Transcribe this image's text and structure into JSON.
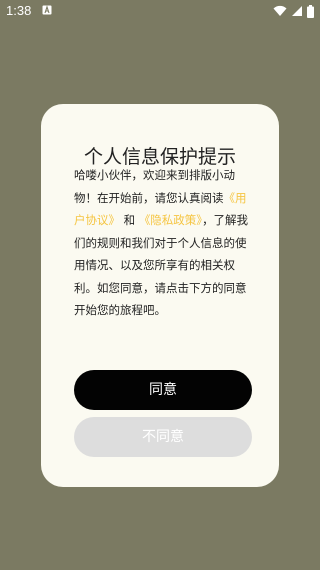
{
  "status_bar": {
    "time": "1:38",
    "notification_icon": "a-box-icon",
    "right_icons": [
      "wifi-icon",
      "cellular-signal-icon",
      "battery-icon"
    ]
  },
  "dialog": {
    "title": "个人信息保护提示",
    "body": {
      "intro": "哈喽小伙伴，欢迎来到排版小动物！在开始前，请您认真阅读",
      "user_agreement_link": "《用户协议》",
      "and": "和",
      "privacy_policy_link": "《隐私政策》",
      "outro": "，了解我们的规则和我们对于个人信息的使用情况、以及您所享有的相关权利。如您同意，请点击下方的同意开始您的旅程吧。"
    },
    "agree_button": "同意",
    "disagree_button": "不同意"
  },
  "colors": {
    "backdrop": "#7b7a62",
    "dialog_bg": "#fbfaf1",
    "link": "#f5c542",
    "agree_button_bg": "#030303",
    "disagree_button_bg": "#dddddd"
  }
}
